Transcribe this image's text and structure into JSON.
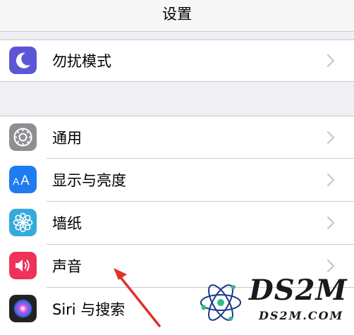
{
  "nav": {
    "title": "设置"
  },
  "rows": [
    {
      "label": "勿扰模式",
      "icon": "moon-icon",
      "icon_color": "#5c56d6"
    },
    {
      "label": "通用",
      "icon": "gear-icon",
      "icon_color": "#8e8e93"
    },
    {
      "label": "显示与亮度",
      "icon": "text-size-icon",
      "icon_color": "#1f7bf0"
    },
    {
      "label": "墙纸",
      "icon": "flower-icon",
      "icon_color": "#35aadc"
    },
    {
      "label": "声音",
      "icon": "speaker-icon",
      "icon_color": "#f0315a"
    },
    {
      "label": "Siri 与搜索",
      "icon": "siri-icon",
      "icon_color": "#222222"
    }
  ],
  "watermark": {
    "title": "DS2M",
    "url": "DS2M.COM"
  },
  "colors": {
    "background": "#efeff4",
    "separator": "#c8c7cc",
    "chevron": "#c7c7cc",
    "annotation_arrow": "#e0312b"
  }
}
